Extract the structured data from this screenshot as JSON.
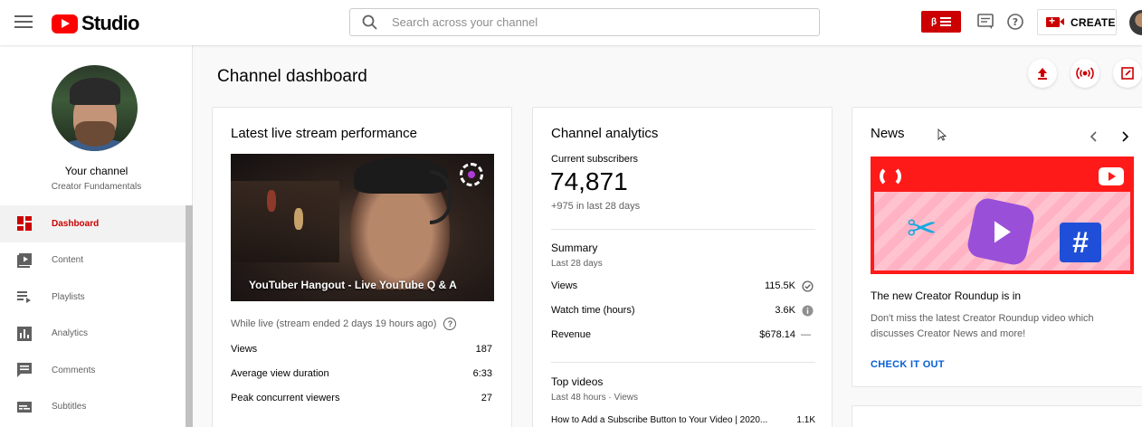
{
  "header": {
    "app_name": "Studio",
    "search_placeholder": "Search across your channel",
    "beta_badge": "β",
    "create_label": "CREATE"
  },
  "sidebar": {
    "channel_label": "Your channel",
    "channel_name": "Creator Fundamentals",
    "items": [
      {
        "label": "Dashboard",
        "icon": "dashboard-icon",
        "active": true
      },
      {
        "label": "Content",
        "icon": "content-icon"
      },
      {
        "label": "Playlists",
        "icon": "playlists-icon"
      },
      {
        "label": "Analytics",
        "icon": "analytics-icon"
      },
      {
        "label": "Comments",
        "icon": "comments-icon"
      },
      {
        "label": "Subtitles",
        "icon": "subtitles-icon"
      }
    ]
  },
  "main": {
    "title": "Channel dashboard"
  },
  "live": {
    "title": "Latest live stream performance",
    "video_title": "YouTuber Hangout - Live YouTube Q & A",
    "note": "While live (stream ended 2 days 19 hours ago)",
    "stats": [
      {
        "label": "Views",
        "value": "187"
      },
      {
        "label": "Average view duration",
        "value": "6:33"
      },
      {
        "label": "Peak concurrent viewers",
        "value": "27"
      }
    ]
  },
  "analytics": {
    "title": "Channel analytics",
    "subs_label": "Current subscribers",
    "subs_value": "74,871",
    "subs_change": "+975 in last 28 days",
    "summary_title": "Summary",
    "summary_period": "Last 28 days",
    "summary_rows": [
      {
        "label": "Views",
        "value": "115.5K",
        "indicator": "check"
      },
      {
        "label": "Watch time (hours)",
        "value": "3.6K",
        "indicator": "info"
      },
      {
        "label": "Revenue",
        "value": "$678.14",
        "indicator": "—"
      }
    ],
    "top_title": "Top videos",
    "top_period": "Last 48 hours · Views",
    "top_rows": [
      {
        "label": "How to Add a Subscribe Button to Your Video | 2020...",
        "value": "1.1K"
      }
    ]
  },
  "news": {
    "title": "News",
    "headline": "The new Creator Roundup is in",
    "body": "Don't miss the latest Creator Roundup video which discusses Creator News and more!",
    "cta": "CHECK IT OUT"
  },
  "colors": {
    "brand_red": "#ff0000",
    "active_red": "#cc0000",
    "link_blue": "#065fd4"
  }
}
